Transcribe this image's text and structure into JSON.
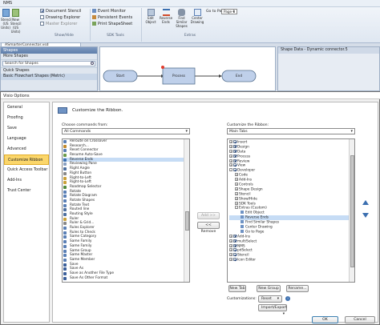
{
  "window": {
    "title": "NMS"
  },
  "ribbon": {
    "show_hide": {
      "items": [
        {
          "label": "Document Stencil",
          "checked": true
        },
        {
          "label": "Drawing Explorer",
          "checked": false
        },
        {
          "label": "Master Explorer",
          "checked": false
        }
      ],
      "group_label": "Show/Hide"
    },
    "sdk_tools": {
      "items": [
        {
          "label": "Event Monitor"
        },
        {
          "label": "Persistent Events"
        },
        {
          "label": "Print ShapeSheet"
        }
      ],
      "group_label": "SDK Tools"
    },
    "left_buttons": [
      "Stencil (US Units)",
      "New Stencil (US Units)"
    ],
    "extras": {
      "buttons": [
        "Edit Object",
        "Reverse Ends",
        "Find Similar Shapes",
        "Center Drawing"
      ],
      "goto_label": "Go to Page",
      "page_value": "Page-1",
      "group_label": "Extras"
    }
  },
  "doc_tab": "ASmarterConnector.vsd",
  "shapes_panel": {
    "header": "Shapes",
    "more_shapes": "More Shapes",
    "search_placeholder": "Search for Shapes",
    "quick_shapes": "Quick Shapes",
    "basic_flowchart": "Basic Flowchart Shapes (Metric)"
  },
  "diagram": {
    "nodes": [
      "Start",
      "Process",
      "End"
    ]
  },
  "shape_data_panel": {
    "header": "Shape Data - Dynamic connector.5"
  },
  "dialog": {
    "title": "Visio Options",
    "nav": [
      "General",
      "Proofing",
      "Save",
      "Language",
      "Advanced",
      "Customize Ribbon",
      "Quick Access Toolbar",
      "Add-Ins",
      "Trust Center"
    ],
    "nav_selected": 5,
    "heading": "Customize the Ribbon.",
    "commands_label": "Choose commands from:",
    "commands_value": "All Commands",
    "customize_label": "Customize the Ribbon:",
    "customize_value": "Main Tabs",
    "commands_list": [
      {
        "label": "Reroute on Crossover",
        "color": "#5a7fb5"
      },
      {
        "label": "Research...",
        "color": "#c28a2d"
      },
      {
        "label": "Reset Connector",
        "color": "#5a7fb5"
      },
      {
        "label": "Resume Auto-Save",
        "color": "#6b9a4a"
      },
      {
        "label": "Reverse Ends",
        "color": "#3b6fb0",
        "selected": true
      },
      {
        "label": "Reviewing Pane",
        "color": "#8aa0c0"
      },
      {
        "label": "Right Angle",
        "color": "#4d6f9f"
      },
      {
        "label": "Right Button",
        "color": "#888888"
      },
      {
        "label": "Right-to-Left",
        "color": "#caa13a"
      },
      {
        "label": "Right-to-Left",
        "color": "#caa13a"
      },
      {
        "label": "Roadmap Selector",
        "color": "#4f8a3c"
      },
      {
        "label": "Rotate",
        "color": "#5a7fb5"
      },
      {
        "label": "Rotate Diagram",
        "color": "#5a7fb5"
      },
      {
        "label": "Rotate Shapes",
        "color": "#5a7fb5"
      },
      {
        "label": "Rotate Text",
        "color": "#5a7fb5"
      },
      {
        "label": "Routed line",
        "color": "#4d6f9f"
      },
      {
        "label": "Routing Style",
        "color": "#4d6f9f"
      },
      {
        "label": "Ruler",
        "color": "#caa13a"
      },
      {
        "label": "Ruler & Grid...",
        "color": "#888888"
      },
      {
        "label": "Rules Explorer",
        "color": "#5a7fb5"
      },
      {
        "label": "Rules to Check",
        "color": "#5a7fb5"
      },
      {
        "label": "Same Category",
        "color": "#5a7fb5"
      },
      {
        "label": "Same Family",
        "color": "#5a7fb5"
      },
      {
        "label": "Same Family",
        "color": "#5a7fb5"
      },
      {
        "label": "Same Group",
        "color": "#5a7fb5"
      },
      {
        "label": "Same Master",
        "color": "#5a7fb5"
      },
      {
        "label": "Same Member",
        "color": "#5a7fb5"
      },
      {
        "label": "Save",
        "color": "#3b5f9a"
      },
      {
        "label": "Save As",
        "color": "#3b5f9a"
      },
      {
        "label": "Save as Another File Type",
        "color": "#3b5f9a"
      },
      {
        "label": "Save As Other Format",
        "color": "#3b5f9a"
      }
    ],
    "tree": [
      {
        "label": "Insert",
        "level": 0,
        "expand": "+",
        "checked": true
      },
      {
        "label": "Design",
        "level": 0,
        "expand": "+",
        "checked": true
      },
      {
        "label": "Data",
        "level": 0,
        "expand": "+",
        "checked": true
      },
      {
        "label": "Process",
        "level": 0,
        "expand": "+",
        "checked": true
      },
      {
        "label": "Review",
        "level": 0,
        "expand": "+",
        "checked": true
      },
      {
        "label": "View",
        "level": 0,
        "expand": "+",
        "checked": true
      },
      {
        "label": "Developer",
        "level": 0,
        "expand": "-",
        "checked": true
      },
      {
        "label": "Code",
        "level": 1,
        "expand": "+"
      },
      {
        "label": "Add-Ins",
        "level": 1,
        "expand": "+"
      },
      {
        "label": "Controls",
        "level": 1,
        "expand": "+"
      },
      {
        "label": "Shape Design",
        "level": 1,
        "expand": "+"
      },
      {
        "label": "Stencil",
        "level": 1,
        "expand": "+"
      },
      {
        "label": "Show/Hide",
        "level": 1,
        "expand": "+"
      },
      {
        "label": "SDK Tools",
        "level": 1,
        "expand": "+"
      },
      {
        "label": "Extras (Custom)",
        "level": 1,
        "expand": "-"
      },
      {
        "label": "Edit Object",
        "level": 2
      },
      {
        "label": "Reverse Ends",
        "level": 2,
        "selected": true
      },
      {
        "label": "Find Similar Shapes",
        "level": 2
      },
      {
        "label": "Center Drawing",
        "level": 2
      },
      {
        "label": "Go to Page",
        "level": 2
      },
      {
        "label": "Add-Ins",
        "level": 0,
        "expand": "+",
        "checked": true
      },
      {
        "label": "multiSelect",
        "level": 0,
        "expand": "+",
        "checked": true
      },
      {
        "label": "NMS",
        "level": 0,
        "expand": "+",
        "checked": true
      },
      {
        "label": "pdSelect",
        "level": 0,
        "expand": "+",
        "checked": true
      },
      {
        "label": "Stencil",
        "level": 0,
        "expand": "+",
        "checked": true
      },
      {
        "label": "Icon Editor",
        "level": 0,
        "expand": "+",
        "checked": true
      }
    ],
    "add_button": "Add >>",
    "remove_button": "<< Remove",
    "new_tab": "New Tab",
    "new_group": "New Group",
    "rename": "Rename...",
    "customizations_label": "Customizations:",
    "reset": "Reset",
    "import_export": "Import/Export",
    "ok": "OK",
    "cancel": "Cancel"
  }
}
